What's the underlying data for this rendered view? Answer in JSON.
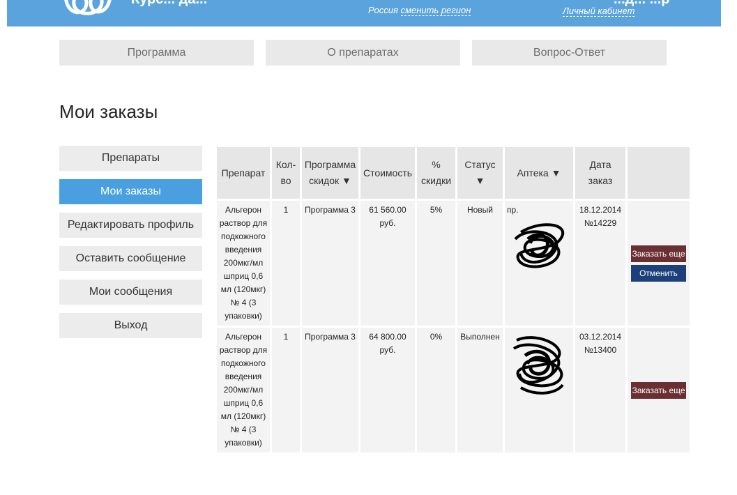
{
  "header": {
    "title": "Курс... да...",
    "right_title": "...д... ...р",
    "region_country": "Россия",
    "region_change": "сменить регион",
    "cabinet": "Личный кабинет"
  },
  "topnav": [
    {
      "label": "Программа"
    },
    {
      "label": "О препаратах"
    },
    {
      "label": "Вопрос-Ответ"
    }
  ],
  "page_title": "Мои заказы",
  "sidebar": [
    {
      "label": "Препараты",
      "active": false
    },
    {
      "label": "Мои заказы",
      "active": true
    },
    {
      "label": "Редактировать профиль",
      "active": false
    },
    {
      "label": "Оставить сообщение",
      "active": false
    },
    {
      "label": "Мои сообщения",
      "active": false
    },
    {
      "label": "Выход",
      "active": false
    }
  ],
  "table": {
    "headers": {
      "drug": "Препарат",
      "qty": "Кол-во",
      "program": "Программа скидок ▼",
      "cost": "Стоимость",
      "discount": "% скидки",
      "status": "Статус ▼",
      "pharmacy": "Аптека ▼",
      "date": "Дата заказ"
    },
    "rows": [
      {
        "drug": "Альгерон раствор для подкожного введения 200мкг/мл шприц 0,6 мл (120мкг) № 4 (3 упаковки)",
        "qty": "1",
        "program": "Программа 3",
        "cost": "61 560.00 руб.",
        "discount": "5%",
        "status": "Новый",
        "pharmacy": "пр.",
        "date": "18.12.2014 №14229",
        "actions": {
          "order_again": "Заказать еще",
          "cancel": "Отменить"
        }
      },
      {
        "drug": "Альгерон раствор для подкожного введения 200мкг/мл шприц 0,6 мл (120мкг) № 4 (3 упаковки)",
        "qty": "1",
        "program": "Программа 3",
        "cost": "64 800.00 руб.",
        "discount": "0%",
        "status": "Выполнен",
        "pharmacy": "",
        "date": "03.12.2014 №13400",
        "actions": {
          "order_again": "Заказать еще"
        }
      }
    ]
  }
}
